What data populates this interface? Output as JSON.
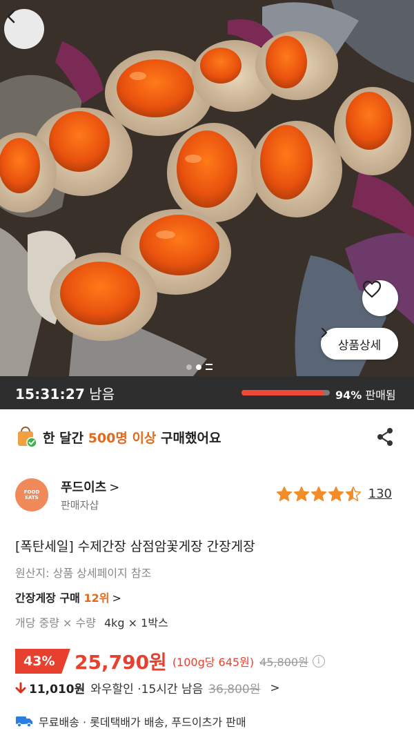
{
  "hero": {
    "detail_label": "상품상세",
    "icons": {
      "back": "back-chevron-icon",
      "wishlist": "heart-outline-icon",
      "detail_chevron": "chevron-right-icon"
    }
  },
  "timer": {
    "time": "15:31:27",
    "suffix": "남음",
    "sold_percent_value": 94,
    "sold_percent": "94%",
    "sold_label": "판매됨"
  },
  "social_proof": {
    "prefix": "한 달간",
    "count": "500명 이상",
    "suffix": "구매했어요",
    "icons": {
      "bag": "shopping-bag-check-icon",
      "share": "share-icon"
    }
  },
  "seller": {
    "logo_text_line1": "FOOD",
    "logo_text_line2": "EATS",
    "name": "푸드이츠",
    "chevron": ">",
    "subtitle": "판매자샵"
  },
  "rating": {
    "stars": 4.5,
    "review_count": "130"
  },
  "product": {
    "title": "[폭탄세일] 수제간장 삼점암꽃게장 간장게장",
    "origin": "원산지: 상품 상세페이지 참조",
    "rank_label": "간장게장 구매",
    "rank_value": "12위",
    "rank_chevron": ">",
    "option_label": "개당 중량 × 수량",
    "option_value": "4kg × 1박스"
  },
  "price": {
    "discount": "43%",
    "sale_price": "25,790원",
    "unit_price": "(100g당 645원)",
    "original_price": "45,800원",
    "info_glyph": "i"
  },
  "wow": {
    "arrow": "🡇",
    "amount": "11,010원",
    "label": "와우할인 · ",
    "time_left": "15시간 남음",
    "original": "36,800원",
    "chevron": ">"
  },
  "shipping": {
    "text": "무료배송 · 롯데택배가 배송, 푸드이츠가 판매",
    "icon": "delivery-truck-icon"
  },
  "colors": {
    "accent_red": "#e8402e",
    "accent_orange": "#e5691c",
    "timer_bg": "#2e2e2e",
    "star": "#f28c28"
  }
}
